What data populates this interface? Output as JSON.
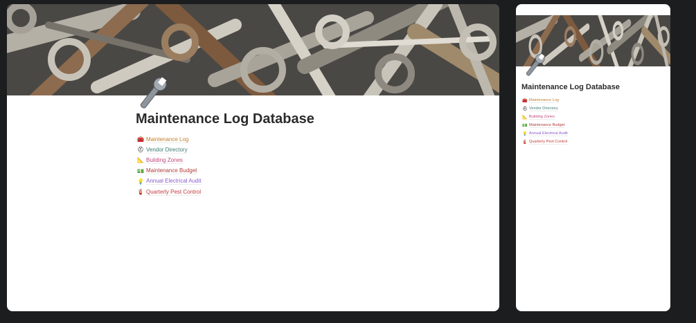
{
  "page": {
    "title": "Maintenance Log Database",
    "links": [
      {
        "label": "Maintenance Log",
        "icon": "toolbox-icon",
        "color": "#c17f2a",
        "glyph": "🧰"
      },
      {
        "label": "Vendor Directory",
        "icon": "hard-hat-icon",
        "color": "#3b7a6e",
        "glyph": "⛑"
      },
      {
        "label": "Building Zones",
        "icon": "floor-plan-icon",
        "color": "#c2457a",
        "glyph": "📐"
      },
      {
        "label": "Maintenance Budget",
        "icon": "money-icon",
        "color": "#b23a3a",
        "glyph": "💵"
      },
      {
        "label": "Annual Electrical Audit",
        "icon": "lightbulb-icon",
        "color": "#8a5cc9",
        "glyph": "💡"
      },
      {
        "label": "Quarterly Pest Control",
        "icon": "fire-extinguisher-icon",
        "color": "#c33b3b",
        "glyph": "🧯"
      }
    ]
  },
  "theme": {
    "background": "#1c1d1f",
    "card_background": "#ffffff",
    "title_color": "#2b2b2b"
  }
}
